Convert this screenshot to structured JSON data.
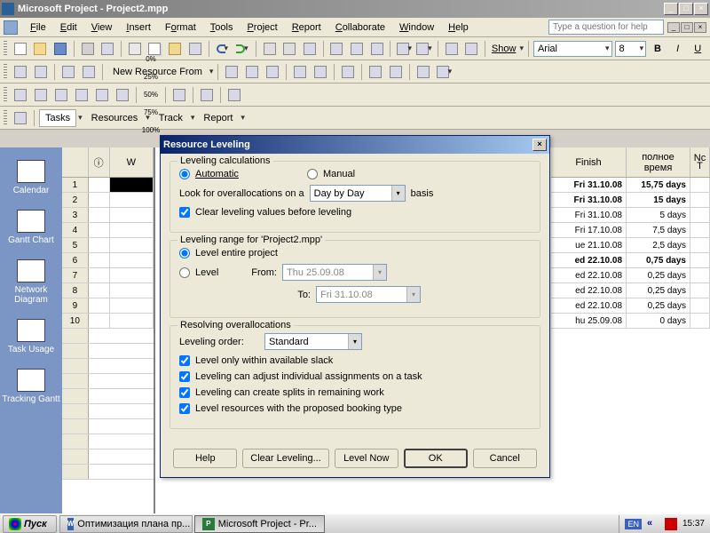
{
  "title": "Microsoft Project - Project2.mpp",
  "menu": [
    "File",
    "Edit",
    "View",
    "Insert",
    "Format",
    "Tools",
    "Project",
    "Report",
    "Collaborate",
    "Window",
    "Help"
  ],
  "menu_accel": [
    "F",
    "E",
    "V",
    "I",
    "o",
    "T",
    "P",
    "R",
    "C",
    "W",
    "H"
  ],
  "help_placeholder": "Type a question for help",
  "toolbar2": {
    "label": "New Resource From",
    "show": "Show",
    "font": "Arial",
    "size": "8",
    "bold": "B",
    "italic": "I",
    "under": "U"
  },
  "pct": [
    "0%",
    "25%",
    "50%",
    "75%",
    "100%"
  ],
  "nav": {
    "tasks": "Tasks",
    "res": "Resources",
    "track": "Track",
    "report": "Report"
  },
  "views": [
    "Calendar",
    "Gantt Chart",
    "Network Diagram",
    "Task Usage",
    "Tracking Gantt"
  ],
  "grid": {
    "hdr_info": "ⓘ",
    "hdr_w": "W",
    "hdr_finish": "Finish",
    "hdr_dur": "полное время",
    "hdr_nc": "Nc T",
    "rows": [
      {
        "n": "1",
        "finish": "Fri 31.10.08",
        "dur": "15,75 days",
        "b": true
      },
      {
        "n": "2",
        "finish": "Fri 31.10.08",
        "dur": "15 days",
        "b": true
      },
      {
        "n": "3",
        "finish": "Fri 31.10.08",
        "dur": "5 days"
      },
      {
        "n": "4",
        "finish": "Fri 17.10.08",
        "dur": "7,5 days"
      },
      {
        "n": "5",
        "finish": "ue 21.10.08",
        "dur": "2,5 days"
      },
      {
        "n": "6",
        "finish": "ed 22.10.08",
        "dur": "0,75 days",
        "b": true
      },
      {
        "n": "7",
        "finish": "ed 22.10.08",
        "dur": "0,25 days"
      },
      {
        "n": "8",
        "finish": "ed 22.10.08",
        "dur": "0,25 days"
      },
      {
        "n": "9",
        "finish": "ed 22.10.08",
        "dur": "0,25 days"
      },
      {
        "n": "10",
        "finish": "hu 25.09.08",
        "dur": "0 days"
      }
    ]
  },
  "dialog": {
    "title": "Resource Leveling",
    "calc_group": "Leveling calculations",
    "auto": "Automatic",
    "manual": "Manual",
    "look": "Look for overallocations on a",
    "basis_val": "Day by Day",
    "basis": "basis",
    "clear": "Clear leveling values before leveling",
    "range_group": "Leveling range for 'Project2.mpp'",
    "entire": "Level entire project",
    "level": "Level",
    "from": "From:",
    "from_val": "Thu 25.09.08",
    "to": "To:",
    "to_val": "Fri 31.10.08",
    "resolve_group": "Resolving overallocations",
    "order_lbl": "Leveling order:",
    "order_val": "Standard",
    "slack": "Level only within available slack",
    "adjust": "Leveling can adjust individual assignments on a task",
    "splits": "Leveling can create splits in remaining work",
    "booking": "Level resources with the proposed booking type",
    "btn_help": "Help",
    "btn_clear": "Clear Leveling...",
    "btn_now": "Level Now",
    "btn_ok": "OK",
    "btn_cancel": "Cancel"
  },
  "taskbar": {
    "start": "Пуск",
    "t1": "Оптимизация плана пр...",
    "t2": "Microsoft Project - Pr...",
    "lang": "EN",
    "time": "15:37"
  }
}
